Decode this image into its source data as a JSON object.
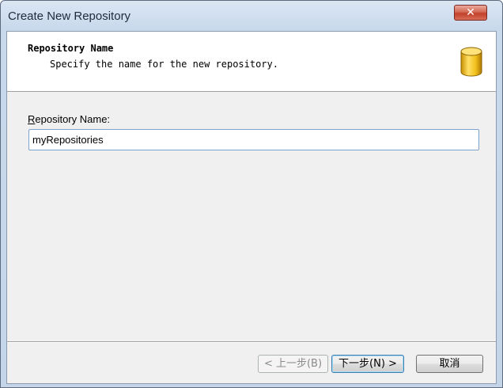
{
  "window": {
    "title": "Create New Repository",
    "close_glyph": "✕"
  },
  "header": {
    "title": "Repository Name",
    "subtitle": "Specify the name for the new repository.",
    "icon": "database-icon"
  },
  "form": {
    "label_mnemonic": "R",
    "label_rest": "epository Name:",
    "input_value": "myRepositories"
  },
  "buttons": {
    "back_label": "< 上一步(B)",
    "next_label": "下一步(N) >",
    "cancel_label": "取消"
  },
  "colors": {
    "title_bar": "#c9d9ec",
    "close_button": "#c2402a",
    "input_border": "#7da2ce",
    "database_icon": "#f2c21d"
  }
}
